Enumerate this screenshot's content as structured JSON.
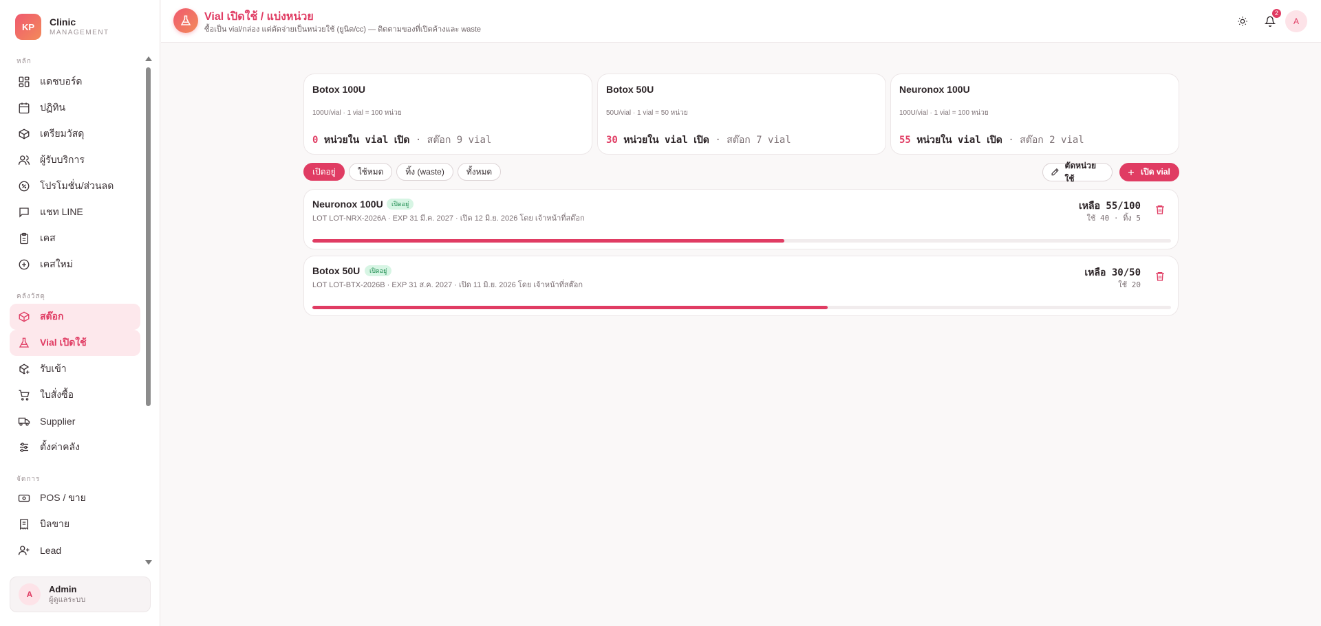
{
  "brand": {
    "logo": "KP",
    "name": "Clinic",
    "sub": "MANAGEMENT"
  },
  "sidebar": {
    "sections": [
      {
        "label": "หลัก"
      },
      {
        "label": "คลังวัสดุ"
      },
      {
        "label": "จัดการ"
      }
    ],
    "items": [
      {
        "label": "แดชบอร์ด",
        "icon": "dashboard-icon"
      },
      {
        "label": "ปฏิทิน",
        "icon": "calendar-icon"
      },
      {
        "label": "เตรียมวัสดุ",
        "icon": "package-icon"
      },
      {
        "label": "ผู้รับบริการ",
        "icon": "users-icon"
      },
      {
        "label": "โปรโมชั่น/ส่วนลด",
        "icon": "percent-badge-icon"
      },
      {
        "label": "แชท LINE",
        "icon": "chat-icon"
      },
      {
        "label": "เคส",
        "icon": "clipboard-icon"
      },
      {
        "label": "เคสใหม่",
        "icon": "plus-circle-icon"
      },
      {
        "label": "สต๊อก",
        "icon": "package-icon",
        "active": true
      },
      {
        "label": "Vial เปิดใช้",
        "icon": "flask-icon",
        "active": true
      },
      {
        "label": "รับเข้า",
        "icon": "package-plus-icon"
      },
      {
        "label": "ใบสั่งซื้อ",
        "icon": "cart-icon"
      },
      {
        "label": "Supplier",
        "icon": "truck-icon"
      },
      {
        "label": "ตั้งค่าคลัง",
        "icon": "sliders-icon"
      },
      {
        "label": "POS / ขาย",
        "icon": "banknote-icon"
      },
      {
        "label": "บิลขาย",
        "icon": "receipt-icon"
      },
      {
        "label": "Lead",
        "icon": "user-plus-icon"
      }
    ]
  },
  "user": {
    "initial": "A",
    "name": "Admin",
    "role": "ผู้ดูแลระบบ"
  },
  "header": {
    "title": "Vial เปิดใช้ / แบ่งหน่วย",
    "subtitle": "ซื้อเป็น vial/กล่อง แต่ตัดจ่ายเป็นหน่วยใช้ (ยูนิต/cc) — ติดตามของที่เปิดค้างและ waste",
    "notification_count": "2",
    "avatar": "A"
  },
  "summary_cards": [
    {
      "name": "Botox 100U",
      "spec": "100U/vial · 1 vial = 100 หน่วย",
      "open_units": "0",
      "open_label": "หน่วยใน vial เปิด",
      "stock_label": "· สต๊อก 9 vial"
    },
    {
      "name": "Botox 50U",
      "spec": "50U/vial · 1 vial = 50 หน่วย",
      "open_units": "30",
      "open_label": "หน่วยใน vial เปิด",
      "stock_label": "· สต๊อก 7 vial"
    },
    {
      "name": "Neuronox 100U",
      "spec": "100U/vial · 1 vial = 100 หน่วย",
      "open_units": "55",
      "open_label": "หน่วยใน vial เปิด",
      "stock_label": "· สต๊อก 2 vial"
    }
  ],
  "filters": [
    {
      "label": "เปิดอยู่",
      "active": true
    },
    {
      "label": "ใช้หมด"
    },
    {
      "label": "ทิ้ง (waste)"
    },
    {
      "label": "ทั้งหมด"
    }
  ],
  "actions": {
    "cut_label": "ตัดหน่วยใช้",
    "open_label": "เปิด vial"
  },
  "vials": [
    {
      "name": "Neuronox 100U",
      "status": "เปิดอยู่",
      "meta": "LOT LOT-NRX-2026A · EXP 31 มี.ค. 2027 · เปิด 12 มิ.ย. 2026 โดย เจ้าหน้าที่สต๊อก",
      "remaining": "เหลือ 55/100",
      "usage": "ใช้ 40 · ทิ้ง 5",
      "fraction": 0.55
    },
    {
      "name": "Botox 50U",
      "status": "เปิดอยู่",
      "meta": "LOT LOT-BTX-2026B · EXP 31 ส.ค. 2027 · เปิด 11 มิ.ย. 2026 โดย เจ้าหน้าที่สต๊อก",
      "remaining": "เหลือ 30/50",
      "usage": "ใช้ 20",
      "fraction": 0.6
    }
  ],
  "colors": {
    "accent": "#e03c63",
    "accent_soft": "#fde8ec",
    "status_green": "#1a8a4d"
  }
}
